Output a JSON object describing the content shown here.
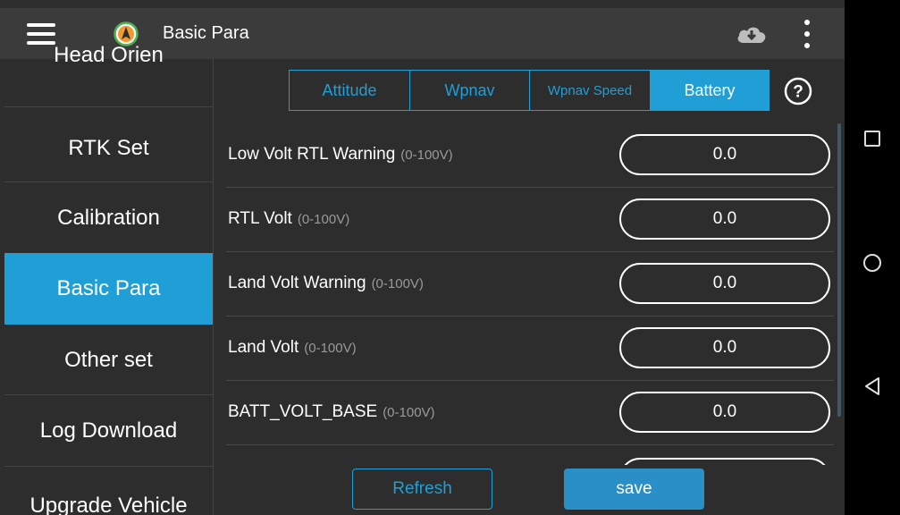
{
  "header": {
    "title": "Basic Para",
    "menu_icon": "menu-icon",
    "logo_icon": "compass-logo-icon",
    "cloud_icon": "cloud-download-icon",
    "more_icon": "more-vert-icon"
  },
  "sidebar": {
    "items": [
      {
        "label": "Head Orien",
        "active": false
      },
      {
        "label": "RTK Set",
        "active": false
      },
      {
        "label": "Calibration",
        "active": false
      },
      {
        "label": "Basic Para",
        "active": true
      },
      {
        "label": "Other set",
        "active": false
      },
      {
        "label": "Log Download",
        "active": false
      },
      {
        "label": "Upgrade Vehicle",
        "active": false
      }
    ]
  },
  "tabs": [
    {
      "label": "Attitude",
      "active": false
    },
    {
      "label": "Wpnav",
      "active": false
    },
    {
      "label": "Wpnav Speed",
      "active": false
    },
    {
      "label": "Battery",
      "active": true
    }
  ],
  "help_icon": "help-circle-icon",
  "params": [
    {
      "label": "Low Volt RTL Warning",
      "range": "(0-100V)",
      "value": "0.0"
    },
    {
      "label": "RTL Volt",
      "range": "(0-100V)",
      "value": "0.0"
    },
    {
      "label": "Land Volt Warning",
      "range": "(0-100V)",
      "value": "0.0"
    },
    {
      "label": "Land Volt",
      "range": "(0-100V)",
      "value": "0.0"
    },
    {
      "label": "BATT_VOLT_BASE",
      "range": "(0-100V)",
      "value": "0.0"
    }
  ],
  "actions": {
    "refresh_label": "Refresh",
    "save_label": "save"
  },
  "colors": {
    "accent": "#1f9fd6",
    "background": "#2d2d2d",
    "topbar": "#3b3b3b",
    "logo": "#f29a2e",
    "logo_ring": "#4caf50"
  },
  "system_nav": {
    "recents_icon": "square-recents-icon",
    "home_icon": "circle-home-icon",
    "back_icon": "triangle-back-icon"
  }
}
